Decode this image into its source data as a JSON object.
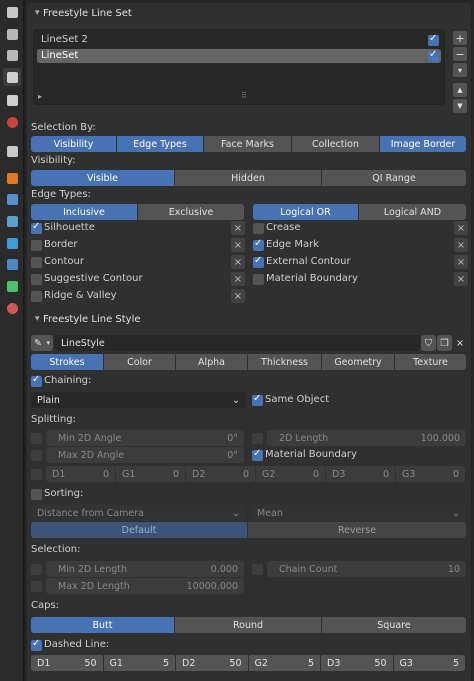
{
  "colors": {
    "accent": "#4772b3",
    "panel": "#303030",
    "button": "#545454"
  },
  "toolbar": {
    "icons": [
      "tool-icon",
      "render-icon",
      "output-icon",
      "view-layer-icon",
      "scene-icon",
      "world-icon",
      "collection-icon",
      "object-icon",
      "modifier-icon",
      "particles-icon",
      "physics-icon",
      "constraints-icon",
      "data-icon",
      "material-icon"
    ]
  },
  "lineset_panel": {
    "title": "Freestyle Line Set",
    "items": [
      {
        "label": "LineSet 2",
        "checked": true
      },
      {
        "label": "LineSet",
        "checked": true
      }
    ],
    "selection_by_label": "Selection By:",
    "selection_by": [
      "Visibility",
      "Edge Types",
      "Face Marks",
      "Collection",
      "Image Border"
    ],
    "visibility_label": "Visibility:",
    "visibility": [
      "Visible",
      "Hidden",
      "QI Range"
    ],
    "edge_types_label": "Edge Types:",
    "inclusion": [
      "Inclusive",
      "Exclusive"
    ],
    "logic": [
      "Logical OR",
      "Logical AND"
    ],
    "edges_left": [
      {
        "label": "Silhouette",
        "checked": true
      },
      {
        "label": "Border",
        "checked": false
      },
      {
        "label": "Contour",
        "checked": false
      },
      {
        "label": "Suggestive Contour",
        "checked": false
      },
      {
        "label": "Ridge & Valley",
        "checked": false
      }
    ],
    "edges_right": [
      {
        "label": "Crease",
        "checked": false
      },
      {
        "label": "Edge Mark",
        "checked": true
      },
      {
        "label": "External Contour",
        "checked": true
      },
      {
        "label": "Material Boundary",
        "checked": false
      }
    ],
    "x_glyph": "×"
  },
  "linestyle_panel": {
    "title": "Freestyle Line Style",
    "style_name": "LineStyle",
    "tabs": [
      "Strokes",
      "Color",
      "Alpha",
      "Thickness",
      "Geometry",
      "Texture"
    ],
    "chaining_label": "Chaining:",
    "chaining_type": "Plain",
    "same_object": "Same Object",
    "splitting_label": "Splitting:",
    "min_2d_angle": {
      "label": "Min 2D Angle",
      "value": "0°"
    },
    "max_2d_angle": {
      "label": "Max 2D Angle",
      "value": "0°"
    },
    "length_2d": {
      "label": "2D Length",
      "value": "100.000"
    },
    "material_boundary": "Material Boundary",
    "split_pattern": [
      {
        "label": "D1",
        "value": "0"
      },
      {
        "label": "G1",
        "value": "0"
      },
      {
        "label": "D2",
        "value": "0"
      },
      {
        "label": "G2",
        "value": "0"
      },
      {
        "label": "D3",
        "value": "0"
      },
      {
        "label": "G3",
        "value": "0"
      }
    ],
    "sorting_label": "Sorting:",
    "sort_key": "Distance from Camera",
    "sort_integration": "Mean",
    "sort_order": [
      "Default",
      "Reverse"
    ],
    "selection_label": "Selection:",
    "min_2d_length": {
      "label": "Min 2D Length",
      "value": "0.000"
    },
    "max_2d_length": {
      "label": "Max 2D Length",
      "value": "10000.000"
    },
    "chain_count": {
      "label": "Chain Count",
      "value": "10"
    },
    "caps_label": "Caps:",
    "caps": [
      "Butt",
      "Round",
      "Square"
    ],
    "dashed_label": "Dashed Line:",
    "dash_pattern": [
      {
        "label": "D1",
        "value": "50"
      },
      {
        "label": "G1",
        "value": "5"
      },
      {
        "label": "D2",
        "value": "50"
      },
      {
        "label": "G2",
        "value": "5"
      },
      {
        "label": "D3",
        "value": "50"
      },
      {
        "label": "G3",
        "value": "5"
      }
    ]
  }
}
